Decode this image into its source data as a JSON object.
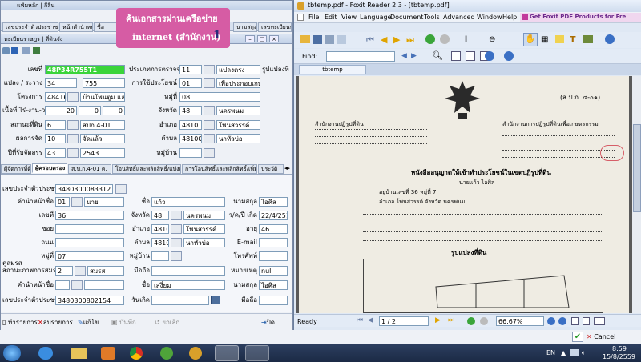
{
  "left_app": {
    "window_title": "แฟ้มหลัก | กีลีน",
    "sub_title": "ทะเบียนราษฎร | ที่ดินจัง",
    "tab_strip_top": [
      "เลขประจำตัวประชาชน",
      "หน้าคำนำหน้า",
      "ชื่อ",
      "นามสกุล",
      "เลขทะเบียนบ้าน"
    ],
    "annotation": {
      "line1": "ค้นเอกสารผ่านเครือข่าย",
      "line2": "internet (สำนักงาน)",
      "number": "1"
    },
    "fields": {
      "doc_no_label": "เลขที่",
      "doc_no": "48P34R755T1",
      "province_check_label": "ประเภทการตรวจจริงวัด",
      "province_check_code": "11",
      "province_check_text": "แปลงตรง",
      "image_label": "รูปแปลงที่",
      "parcel_label": "แปลง / ระวาง",
      "parcel_no": "34",
      "parcel_sheet": "755",
      "landuse_label": "การใช้ประโยชน์",
      "landuse_code": "01",
      "landuse_text": "เพื่อประกอบเกษตรกร",
      "project_label": "โครงการ",
      "project_code": "48416",
      "project_text": "บ้านโพนตูม และบ้านนา",
      "village_label": "หมู่ที่",
      "village_no": "08",
      "area_label": "เนื้อที่ ไร่-งาน-วา",
      "area_rai": "20",
      "area_ngan": "0",
      "area_wa": "0",
      "province_label": "จังหวัด",
      "province_code": "48",
      "province_text": "นครพนม",
      "office_label": "สถานะที่ดิน",
      "office_code": "6",
      "office_text": "สปก 4-01",
      "district_label": "อำเภอ",
      "district_code": "4810",
      "district_text": "โพนสวรรค์",
      "allot_label": "ผลการจัด",
      "allot_code": "10",
      "allot_text": "จัดแล้ว",
      "subdistrict_label": "ตำบล",
      "subdistrict_code": "481002",
      "subdistrict_text": "นาหัวบ่อ",
      "year_label": "ปีที่รับจัดสรร",
      "year_code": "43",
      "year_text": "2543",
      "moo_label": "หมู่บ้าน"
    },
    "mid_tabs": [
      "ผู้จัดการที่ดิน",
      "ผู้ครอบครอง",
      "ส.ป.ก.4-01 ค.",
      "โอนสิทธิ์และพลิกสิทธิ์/แบ่งแปลง",
      "การโอนสิทธิ์และพลิกสิทธิ์/เพิ่มแปลง",
      "ประวัติ"
    ],
    "person": {
      "id_label": "เลขประจำตัวประชาชน",
      "id_value": "3480300083312",
      "prefix_label": "คำนำหน้าชื่อ",
      "prefix_code": "01",
      "prefix_text": "นาย",
      "firstname_label": "ชื่อ",
      "firstname": "แก้ว",
      "lastname_label": "นามสกุล",
      "lastname": "ไอศิล",
      "house_label": "เลขที่",
      "house": "36",
      "prov_label": "จังหวัด",
      "prov_code": "48",
      "prov_text": "นครพนม",
      "dob_label": "ว/ด/ปี เกิด",
      "dob": "22/4/2513",
      "soi_label": "ซอย",
      "amphoe_label": "อำเภอ",
      "amphoe_code": "4810",
      "amphoe_text": "โพนสวรรค์",
      "age_label": "อายุ",
      "age": "46",
      "road_label": "ถนน",
      "tambon_label": "ตำบล",
      "tambon_code": "48100",
      "tambon_text": "นาหัวบ่อ",
      "email_label": "E-mail",
      "moo_label": "หมู่ที่",
      "moo": "07",
      "village_label": "หมู่บ้าน",
      "phone_label": "โทรศัพท์",
      "spouse_group_label": "คู่สมรส",
      "marital_label": "สถานะภาพการสมรส",
      "marital_code": "2",
      "marital_text": "สมรส",
      "mobile_label": "มือถือ",
      "note_label": "หมายเหตุ",
      "note": "null",
      "spouse_prefix_label": "คำนำหน้าชื่อ",
      "spouse_first_label": "ชื่อ",
      "spouse_first": "เสงี่ยม",
      "spouse_last_label": "นามสกุล",
      "spouse_last": "ไอศิล",
      "spouse_id_label": "เลขประจำตัวประชาชน",
      "spouse_id": "3480300802154",
      "date_label": "วันเกิด",
      "spouse_mobile_label": "มือถือ"
    },
    "bottom_buttons": {
      "edit": "ทำรายการ",
      "delete": "ลบรายการ",
      "fix": "แก้ไข",
      "save": "บันทึก",
      "cancel": "ยกเลิก",
      "close": "ปิด"
    }
  },
  "foxit": {
    "title": "tbtemp.pdf - Foxit Reader 2.3 - [tbtemp.pdf]",
    "menu": [
      "File",
      "Edit",
      "View",
      "Language",
      "Document",
      "Tools",
      "Advanced",
      "Window",
      "Help"
    ],
    "promo": "Get Foxit PDF Products for Fre",
    "find_label": "Find:",
    "doc_tab": "tbtemp",
    "status_ready": "Ready",
    "page_indicator": "1 / 2",
    "zoom": "66.67%",
    "doc": {
      "form_no": "(ส.ป.ก. ๔-๐๑)",
      "office_left": "สำนักงานปฏิรูปที่ดิน",
      "office_right": "สำนักงานการปฏิรูปที่ดินเพื่อเกษตรกรรม",
      "heading": "หนังสืออนุญาตให้เข้าทำประโยชน์ในเขตปฏิรูปที่ดิน",
      "name_line": "นายแก้ว  ไอศิล",
      "addr_line": "อยู่บ้านเลขที่ 36  หมู่ที่ 7",
      "district_line": "อำเภอ โพนสวรรค์  จังหวัด นครพนม",
      "image_label": "รูปแปลงที่ดิน"
    }
  },
  "dialog": {
    "ok": "✔",
    "cancel_label": "Cancel"
  },
  "taskbar": {
    "lang": "EN",
    "time": "8:59",
    "date": "15/8/2559"
  }
}
